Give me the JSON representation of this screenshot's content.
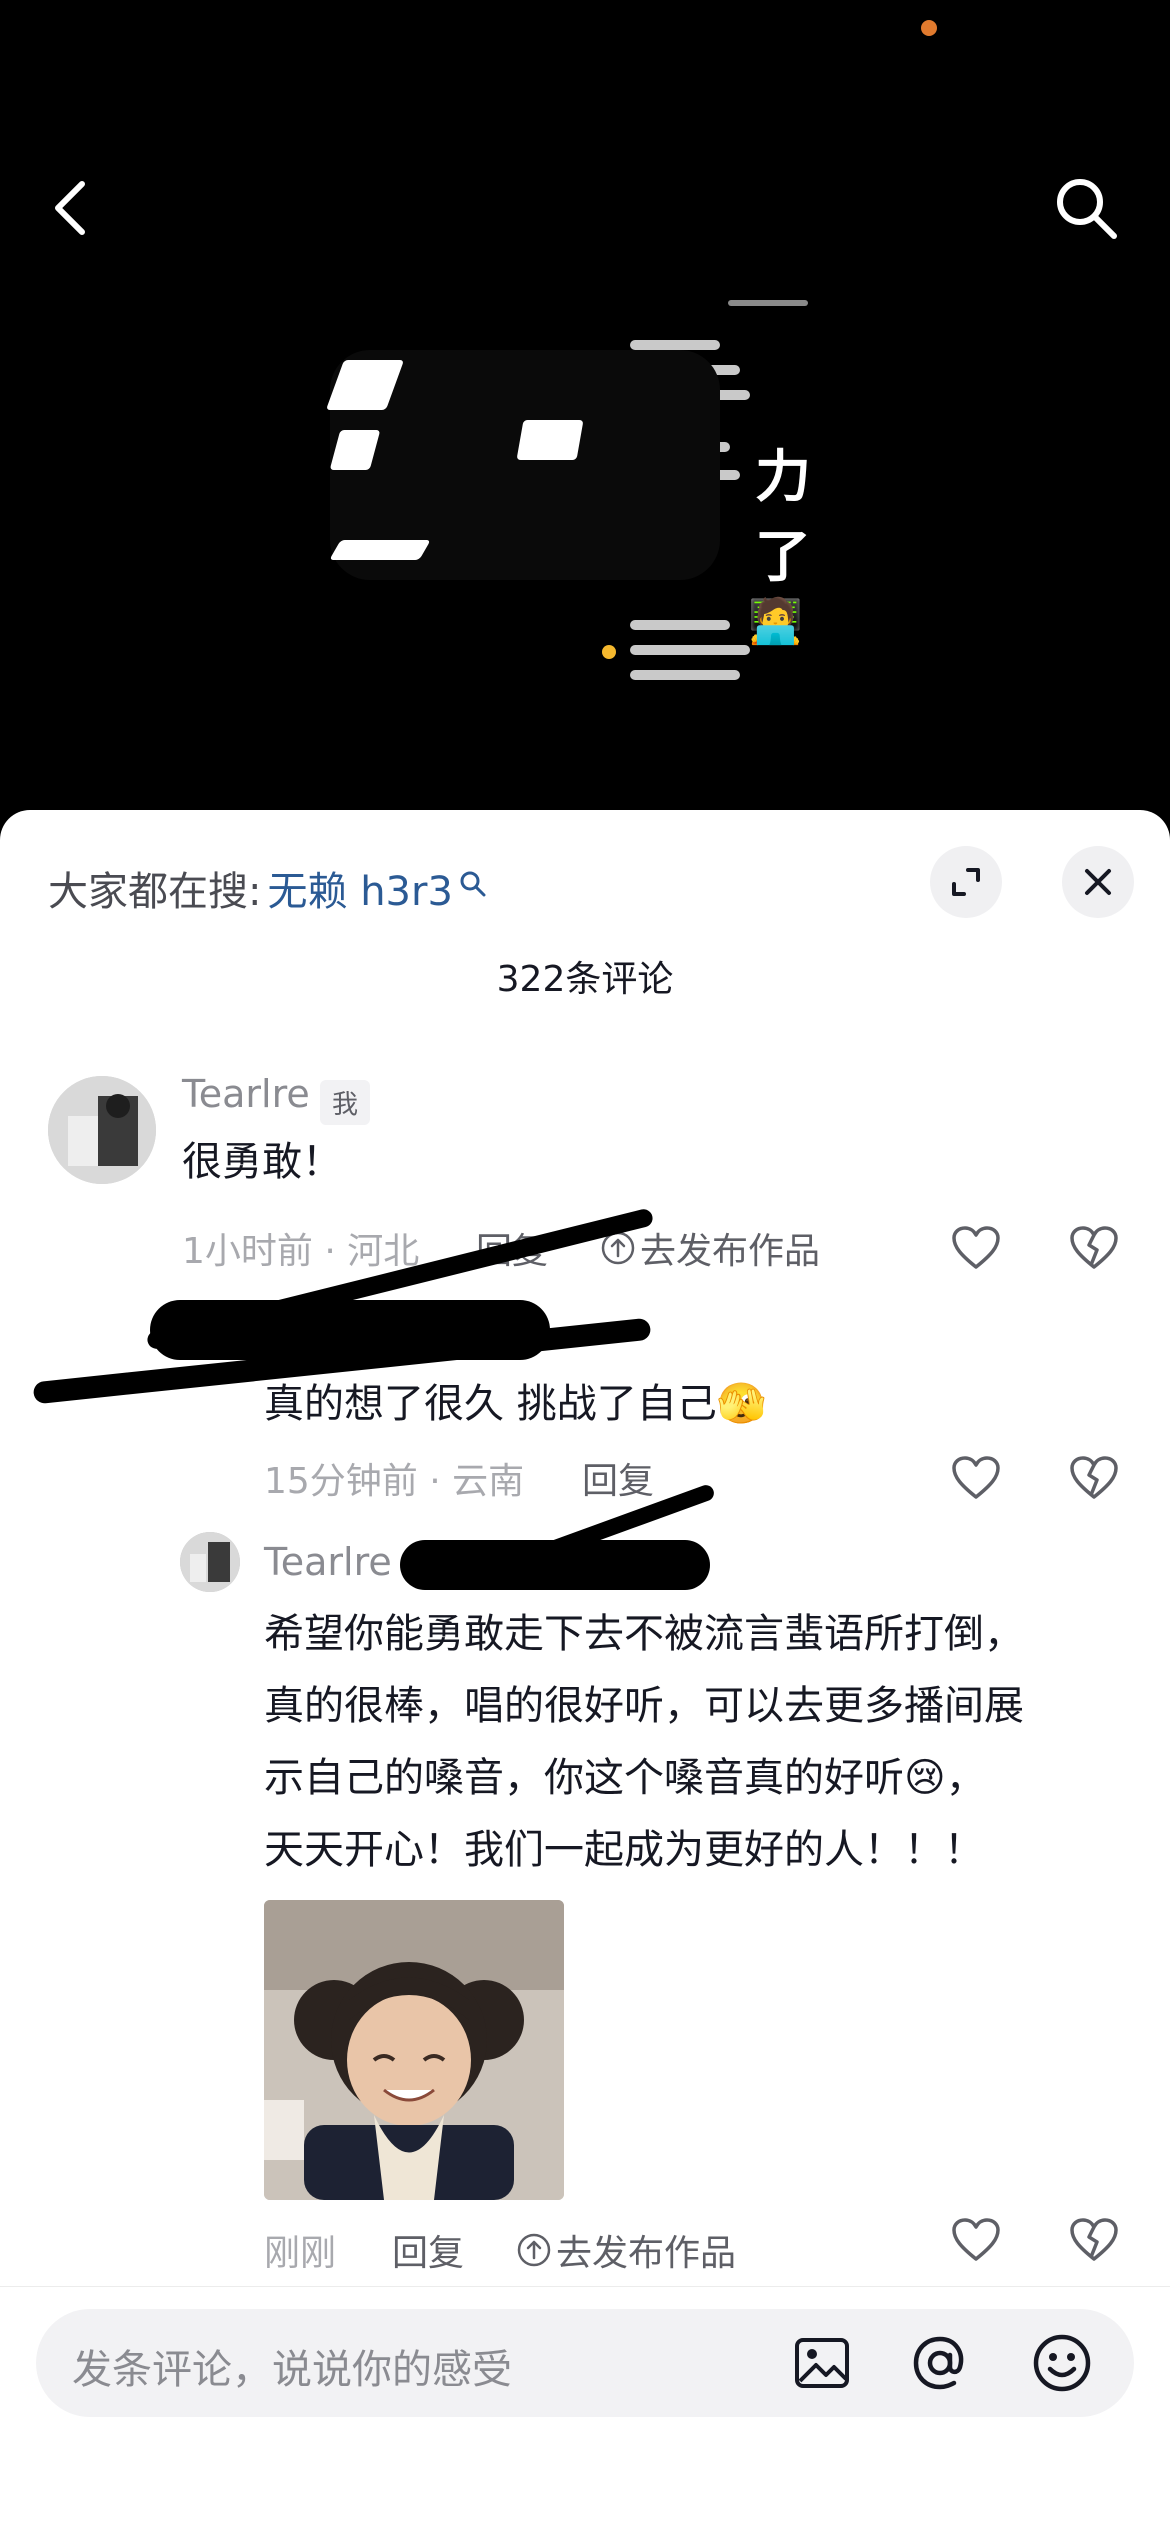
{
  "colors": {
    "status_dot": "#e07a2e",
    "search_term": "#2b5a94",
    "muted": "#a8a9ae",
    "text": "#161823"
  },
  "video": {
    "back_icon": "chevron-left-icon",
    "search_icon": "search-icon",
    "overlay_text_1": "力",
    "overlay_text_2": "了"
  },
  "sheet": {
    "search_prefix": "大家都在搜:",
    "search_term": "无赖 h3r3",
    "expand_icon": "expand-icon",
    "close_icon": "close-icon",
    "comment_count": "322条评论"
  },
  "comments": [
    {
      "username": "Tearlre",
      "badge": "我",
      "text": "很勇敢！",
      "meta": "1小时前 · 河北",
      "reply": "回复",
      "publish": "去发布作品"
    },
    {
      "text": "真的想了很久 挑战了自己🫣",
      "meta": "15分钟前 · 云南",
      "reply": "回复"
    },
    {
      "username": "Tearlre",
      "lines": [
        "希望你能勇敢走下去不被流言蜚语所打倒，",
        "真的很棒，唱的很好听，可以去更多播间展",
        "示自己的嗓音，你这个嗓音真的好听😢，",
        "天天开心！我们一起成为更好的人！！！"
      ],
      "meta": "刚刚",
      "reply": "回复",
      "publish": "去发布作品"
    }
  ],
  "bottom": {
    "placeholder": "发条评论，说说你的感受",
    "image_icon": "image-icon",
    "at_icon": "at-icon",
    "emoji_icon": "emoji-icon"
  }
}
